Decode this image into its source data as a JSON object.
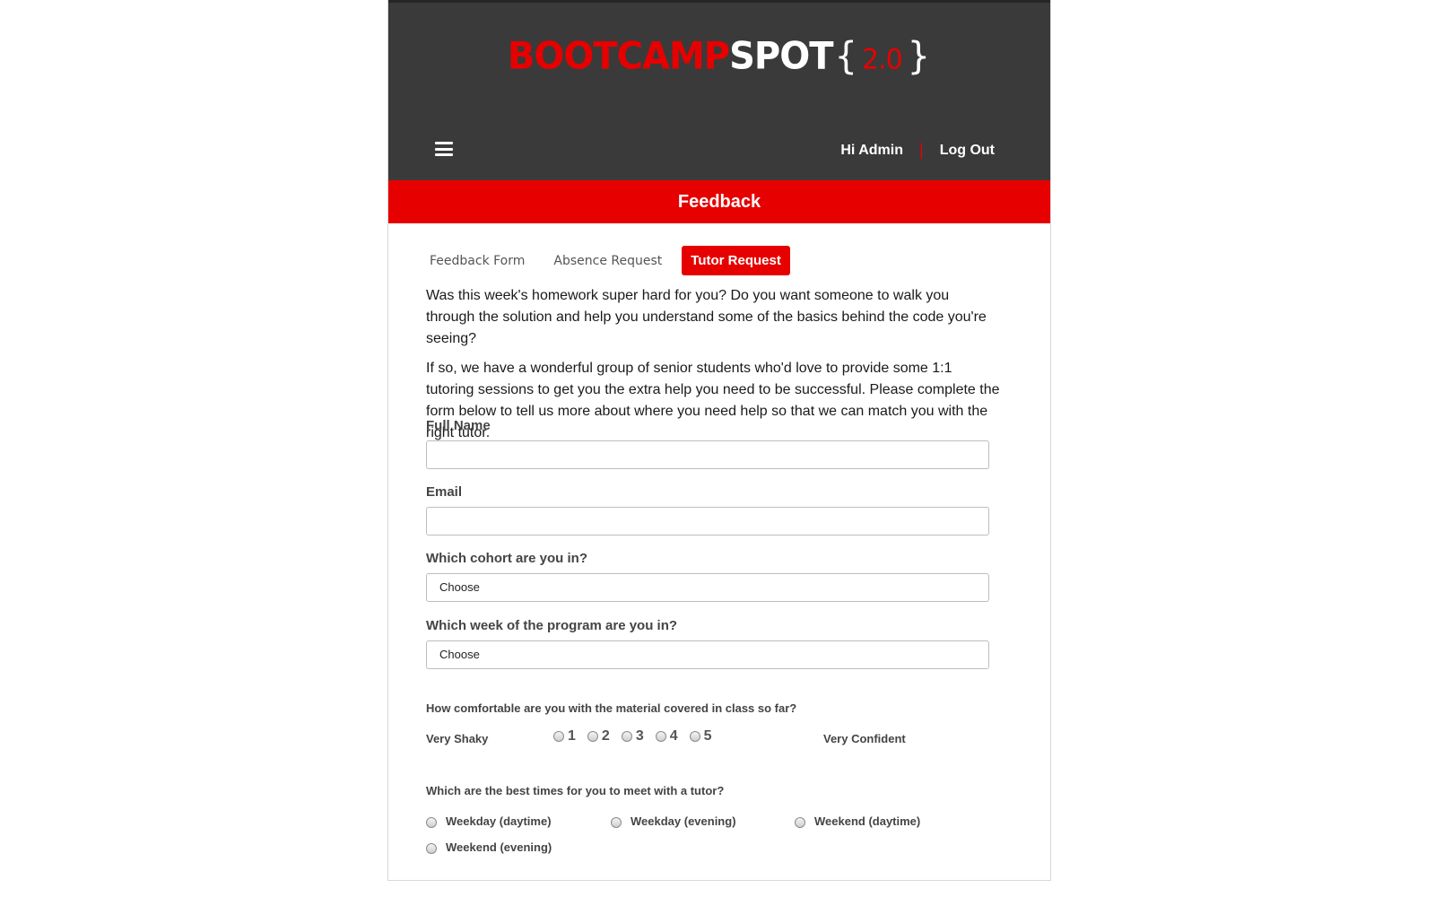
{
  "brand": {
    "logo_part1": "BOOTCAMP",
    "logo_part2": "SPOT",
    "logo_open": "{",
    "logo_version": "2.0",
    "logo_close": "}",
    "accent_color": "#e60000",
    "header_color": "#3a3a3a"
  },
  "header": {
    "greeting": "Hi Admin",
    "separator": "|",
    "logout_label": "Log Out",
    "menu_icon": "hamburger-menu-icon"
  },
  "page": {
    "title": "Feedback"
  },
  "tabs": [
    {
      "label": "Feedback Form",
      "active": false
    },
    {
      "label": "Absence Request",
      "active": false
    },
    {
      "label": "Tutor Request",
      "active": true
    }
  ],
  "intro": {
    "paragraph1": "Was this week's homework super hard for you? Do you want someone to walk you through the solution and help you understand some of the basics behind the code you're seeing?",
    "paragraph2": "If so, we have a wonderful group of senior students who'd love to provide some 1:1 tutoring sessions to get you the extra help you need to be successful. Please complete the form below to tell us more about where you need help so that we can match you with the right tutor."
  },
  "form": {
    "full_name": {
      "label": "Full Name",
      "value": ""
    },
    "email": {
      "label": "Email",
      "value": ""
    },
    "cohort": {
      "label": "Which cohort are you in?",
      "selected": "Choose"
    },
    "week": {
      "label": "Which week of the program are you in?",
      "selected": "Choose"
    },
    "comfort": {
      "question": "How comfortable are you with the material covered in class so far?",
      "low_label": "Very Shaky",
      "high_label": "Very Confident",
      "options": [
        "1",
        "2",
        "3",
        "4",
        "5"
      ]
    },
    "times": {
      "question": "Which are the best times for you to meet with a tutor?",
      "options": [
        "Weekday (daytime)",
        "Weekday (evening)",
        "Weekend (daytime)",
        "Weekend (evening)"
      ]
    }
  }
}
